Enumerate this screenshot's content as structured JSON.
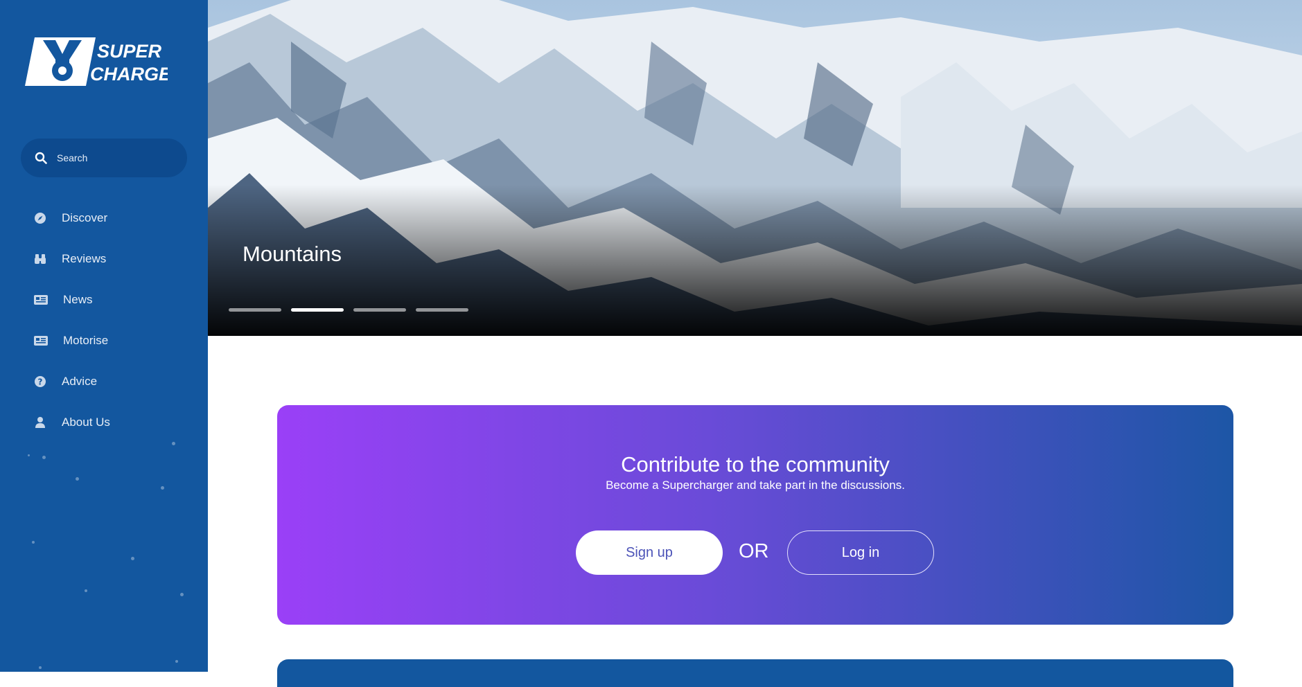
{
  "brand": {
    "logo_text_line1": "SUPER",
    "logo_text_line2": "CHARGED",
    "colors": {
      "sidebar": "#13579f",
      "accent_purple": "#9a40f7",
      "accent_blue": "#1d56a6"
    }
  },
  "search": {
    "placeholder": "Search",
    "icon": "search-icon"
  },
  "sidebar": {
    "items": [
      {
        "label": "Discover",
        "icon": "compass-icon"
      },
      {
        "label": "Reviews",
        "icon": "binoculars-icon"
      },
      {
        "label": "News",
        "icon": "newspaper-icon"
      },
      {
        "label": "Motorise",
        "icon": "newspaper-icon"
      },
      {
        "label": "Advice",
        "icon": "question-circle-icon"
      },
      {
        "label": "About Us",
        "icon": "user-icon"
      }
    ]
  },
  "hero": {
    "title": "Mountains",
    "slides_count": 4,
    "active_slide": 2
  },
  "cta": {
    "title": "Contribute to the community",
    "subtitle": "Become a Supercharger and take part in the discussions.",
    "signup_label": "Sign up",
    "or_label": "OR",
    "login_label": "Log in"
  }
}
